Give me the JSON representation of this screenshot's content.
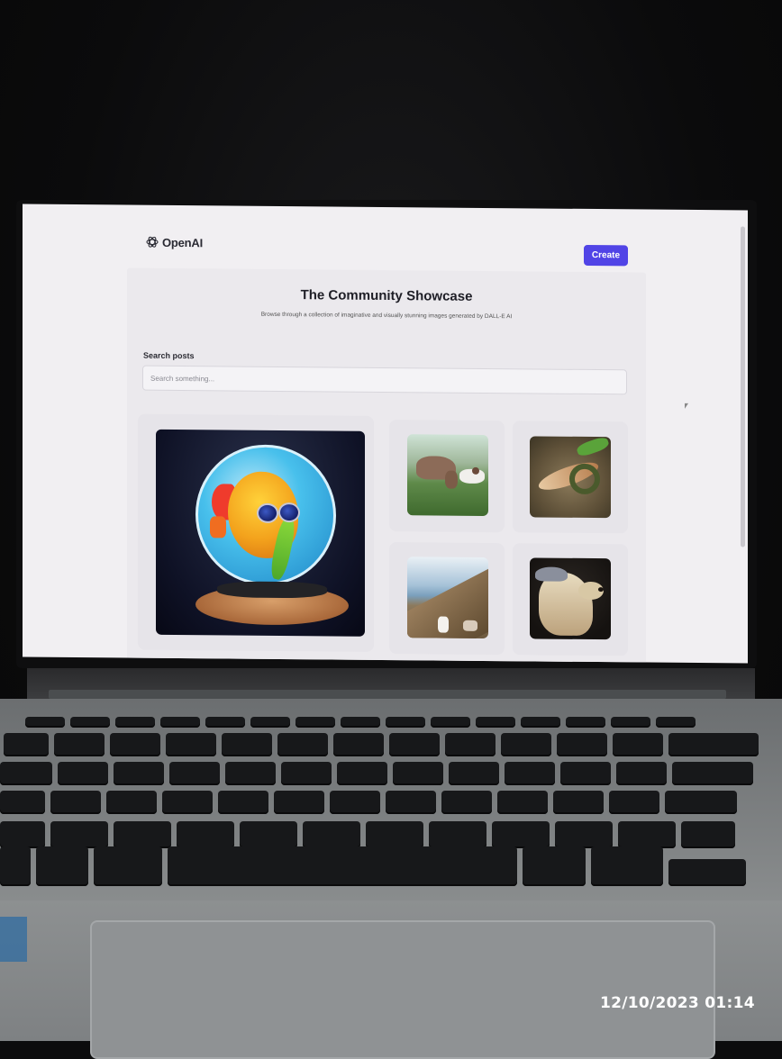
{
  "header": {
    "logo_text": "OpenAI",
    "logo_icon": "openai-logo-icon",
    "create_label": "Create"
  },
  "main": {
    "title": "The Community Showcase",
    "subtitle": "Browse through a collection of imaginative and visually stunning images generated by DALL-E AI"
  },
  "search": {
    "label": "Search posts",
    "placeholder": "Search something..."
  },
  "gallery": {
    "posts": [
      {
        "subject": "fish-in-bowl"
      },
      {
        "subject": "cow-and-dog"
      },
      {
        "subject": "eel-on-ground"
      },
      {
        "subject": "people-on-hillside"
      },
      {
        "subject": "otter-with-cap"
      }
    ]
  },
  "photo": {
    "timestamp": "12/10/2023  01:14"
  },
  "colors": {
    "accent": "#5144e6",
    "screen_background": "#f1eff2"
  }
}
